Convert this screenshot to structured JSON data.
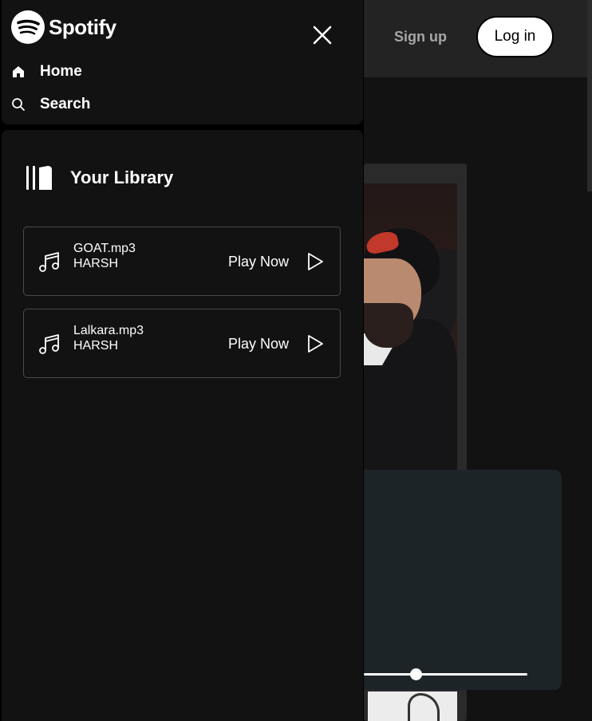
{
  "header": {
    "signup_label": "Sign up",
    "login_label": "Log in"
  },
  "sidebar": {
    "brand": "Spotify",
    "nav": [
      {
        "label": "Home",
        "icon": "home-icon"
      },
      {
        "label": "Search",
        "icon": "search-icon"
      }
    ],
    "library_title": "Your Library",
    "tracks": [
      {
        "name": "GOAT.mp3",
        "artist": "HARSH",
        "action": "Play Now"
      },
      {
        "name": "Lalkara.mp3",
        "artist": "HARSH",
        "action": "Play Now"
      }
    ]
  },
  "player": {
    "progress": 0.32
  },
  "colors": {
    "accent": "#ffffff",
    "panel": "#121212",
    "background": "#000000",
    "player_bg": "#1d2427",
    "header_bg": "#232323"
  }
}
